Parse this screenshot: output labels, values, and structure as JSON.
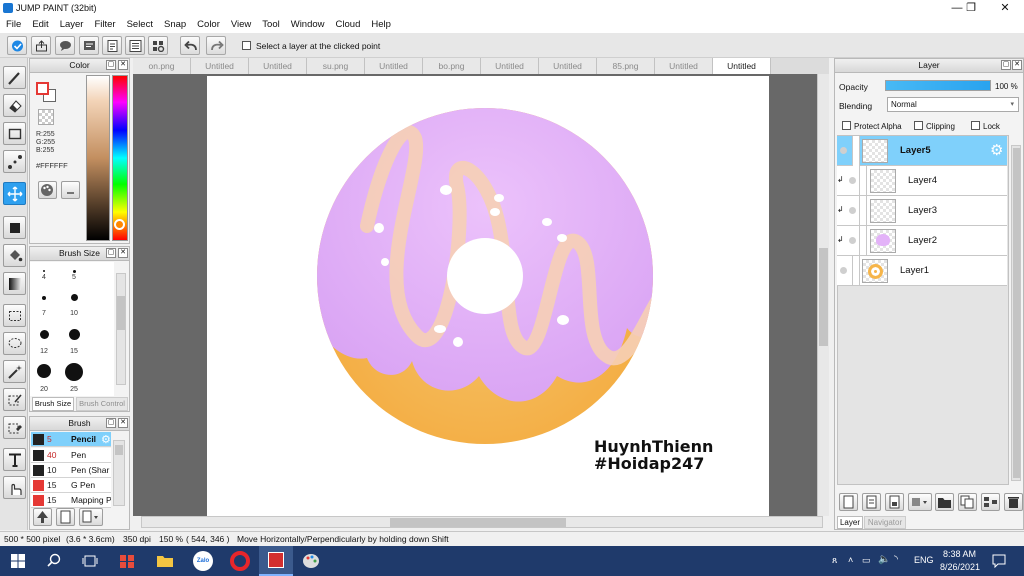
{
  "window": {
    "title": "JUMP PAINT (32bit)",
    "minimize": "—",
    "maximize": "❐",
    "close": "✕"
  },
  "menu": [
    "File",
    "Edit",
    "Layer",
    "Filter",
    "Select",
    "Snap",
    "Color",
    "View",
    "Tool",
    "Window",
    "Cloud",
    "Help"
  ],
  "toolbar": {
    "select_layer_label": "Select a layer at the clicked point"
  },
  "color_panel": {
    "title": "Color",
    "rgb": {
      "r": "R:255",
      "g": "G:255",
      "b": "B:255"
    },
    "hex": "#FFFFFF",
    "primary": "#ffffff",
    "secondary": "#ffffff"
  },
  "brush_size_panel": {
    "title": "Brush Size",
    "sizes": [
      "4",
      "5",
      "7",
      "10",
      "12",
      "15",
      "20",
      "25"
    ],
    "tabs": [
      "Brush Size",
      "Brush Control"
    ]
  },
  "brush_panel": {
    "title": "Brush",
    "brushes": [
      {
        "size": "5",
        "name": "Pencil"
      },
      {
        "size": "40",
        "name": "Pen"
      },
      {
        "size": "10",
        "name": "Pen (Shar"
      },
      {
        "size": "15",
        "name": "G Pen"
      },
      {
        "size": "15",
        "name": "Mapping P"
      }
    ]
  },
  "tabs": [
    "on.png",
    "Untitled",
    "Untitled",
    "su.png",
    "Untitled",
    "bo.png",
    "Untitled",
    "Untitled",
    "85.png",
    "Untitled",
    "Untitled"
  ],
  "active_tab_index": 10,
  "watermark": {
    "line1": "HuynhThienn",
    "line2": "#Hoidap247"
  },
  "layer_panel": {
    "title": "Layer",
    "opacity_label": "Opacity",
    "opacity_value": "100 %",
    "opacity_fraction": 1.0,
    "blending_label": "Blending",
    "blending_value": "Normal",
    "protect_alpha": "Protect Alpha",
    "clipping": "Clipping",
    "lock": "Lock",
    "layers": [
      "Layer5",
      "Layer4",
      "Layer3",
      "Layer2",
      "Layer1"
    ],
    "selected_layer": "Layer5",
    "bottom_tabs": [
      "Layer",
      "Navigator"
    ]
  },
  "status": {
    "size": "500 * 500 pixel",
    "cm": "(3.6 * 3.6cm)",
    "dpi": "350 dpi",
    "zoom": "150 %",
    "coords": "( 544, 346 )",
    "hint": "Move Horizontally/Perpendicularly by holding down Shift"
  },
  "taskbar": {
    "time": "8:38 AM",
    "date": "8/26/2021",
    "lang": "ENG",
    "zalo": "Zalo"
  },
  "colors": {
    "accent": "#2ea0ef",
    "layer_selected": "#7fd0fb",
    "donut_icing": "#e3b2f8",
    "donut_dough": "#f6b54a",
    "taskbar": "#1f3a6b"
  }
}
